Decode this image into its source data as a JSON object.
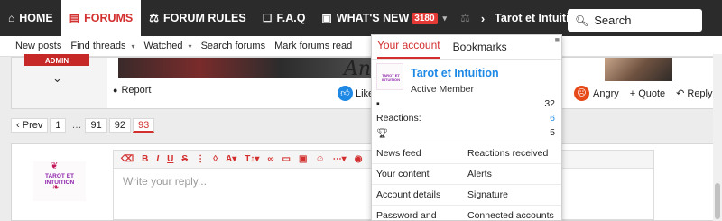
{
  "nav": {
    "home": "HOME",
    "forums": "FORUMS",
    "forum_rules": "FORUM RULES",
    "faq": "F.A.Q",
    "whats_new": "WHAT'S NEW",
    "whats_new_count": "3180",
    "user": "Tarot et Intuition",
    "search_label": "Search"
  },
  "subnav": {
    "new_posts": "New posts",
    "find_threads": "Find threads",
    "watched": "Watched",
    "search_forums": "Search forums",
    "mark_read": "Mark forums read"
  },
  "post": {
    "badge": "ADMIN",
    "signature": "And",
    "report": "Report",
    "like": "Like",
    "angry": "Angry",
    "quote": "Quote",
    "reply": "Reply"
  },
  "pagination": {
    "prev": "Prev",
    "pages": [
      "1",
      "91",
      "92",
      "93"
    ],
    "dots": "…",
    "current": "93"
  },
  "reply": {
    "avatar_name": "TAROT ET INTUITION",
    "placeholder": "Write your reply..."
  },
  "account_menu": {
    "tab_account": "Your account",
    "tab_bookmarks": "Bookmarks",
    "username": "Tarot et Intuition",
    "user_title": "Active Member",
    "avatar_text": "TAROT ET INTUITION",
    "stats": [
      {
        "label": "",
        "icon": "message-icon",
        "value": "32"
      },
      {
        "label": "Reactions:",
        "icon": "",
        "value": "6"
      },
      {
        "label": "",
        "icon": "trophy-icon",
        "value": "5"
      }
    ],
    "links": [
      [
        "News feed",
        "Reactions received"
      ],
      [
        "Your content",
        "Alerts"
      ],
      [
        "Account details",
        "Signature"
      ],
      [
        "Password and",
        "Connected accounts"
      ]
    ]
  },
  "colors": {
    "nav_bg": "#2b2b2b",
    "accent_red": "#d32f2f",
    "link_blue": "#1e88e5"
  }
}
